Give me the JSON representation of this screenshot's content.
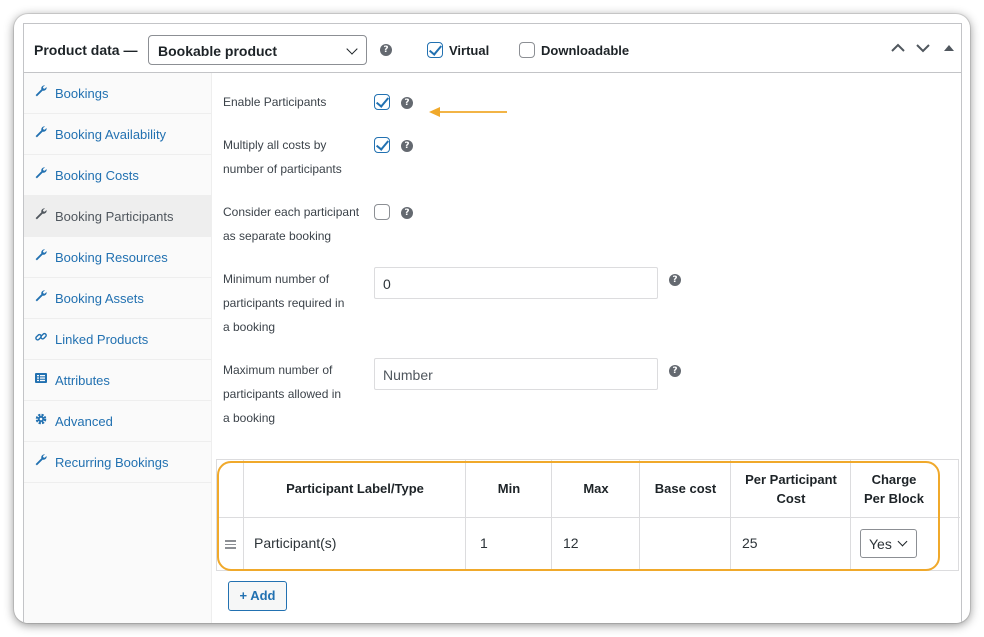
{
  "header": {
    "title": "Product data —",
    "product_type": "Bookable product",
    "virtual_label": "Virtual",
    "virtual_checked": true,
    "downloadable_label": "Downloadable",
    "downloadable_checked": false,
    "help_glyph": "?"
  },
  "sidebar": {
    "active": "Booking Participants",
    "items": [
      {
        "label": "Bookings",
        "icon": "wrench-icon"
      },
      {
        "label": "Booking Availability",
        "icon": "wrench-icon"
      },
      {
        "label": "Booking Costs",
        "icon": "wrench-icon"
      },
      {
        "label": "Booking Participants",
        "icon": "wrench-icon"
      },
      {
        "label": "Booking Resources",
        "icon": "wrench-icon"
      },
      {
        "label": "Booking Assets",
        "icon": "wrench-icon"
      },
      {
        "label": "Linked Products",
        "icon": "link-icon"
      },
      {
        "label": "Attributes",
        "icon": "list-icon"
      },
      {
        "label": "Advanced",
        "icon": "gear-icon"
      },
      {
        "label": "Recurring Bookings",
        "icon": "wrench-icon"
      }
    ]
  },
  "form": {
    "enable_participants": {
      "label": "Enable Participants",
      "checked": true
    },
    "multiply_costs": {
      "label_line1": "Multiply all costs by",
      "label_line2": "number of participants",
      "checked": true
    },
    "separate_booking": {
      "label_line1": "Consider each participant",
      "label_line2": "as separate booking",
      "checked": false
    },
    "min_participants": {
      "label_line1": "Minimum number of",
      "label_line2": "participants required in",
      "label_line3": "a booking",
      "value": "0"
    },
    "max_participants": {
      "label_line1": "Maximum number of",
      "label_line2": "participants allowed in",
      "label_line3": "a booking",
      "placeholder": "Number"
    }
  },
  "table": {
    "headers": {
      "label_type": "Participant Label/Type",
      "min": "Min",
      "max": "Max",
      "base_cost": "Base cost",
      "per_participant_1": "Per Participant",
      "per_participant_2": "Cost",
      "charge_1": "Charge",
      "charge_2": "Per Block"
    },
    "rows": [
      {
        "label": "Participant(s)",
        "min": "1",
        "max": "12",
        "base_cost": "",
        "per_participant_cost": "25",
        "charge_per_block": "Yes"
      }
    ]
  },
  "add_button": "+ Add",
  "colors": {
    "accent": "#2271b1",
    "highlight": "#f0a92b",
    "text": "#3c434a"
  }
}
